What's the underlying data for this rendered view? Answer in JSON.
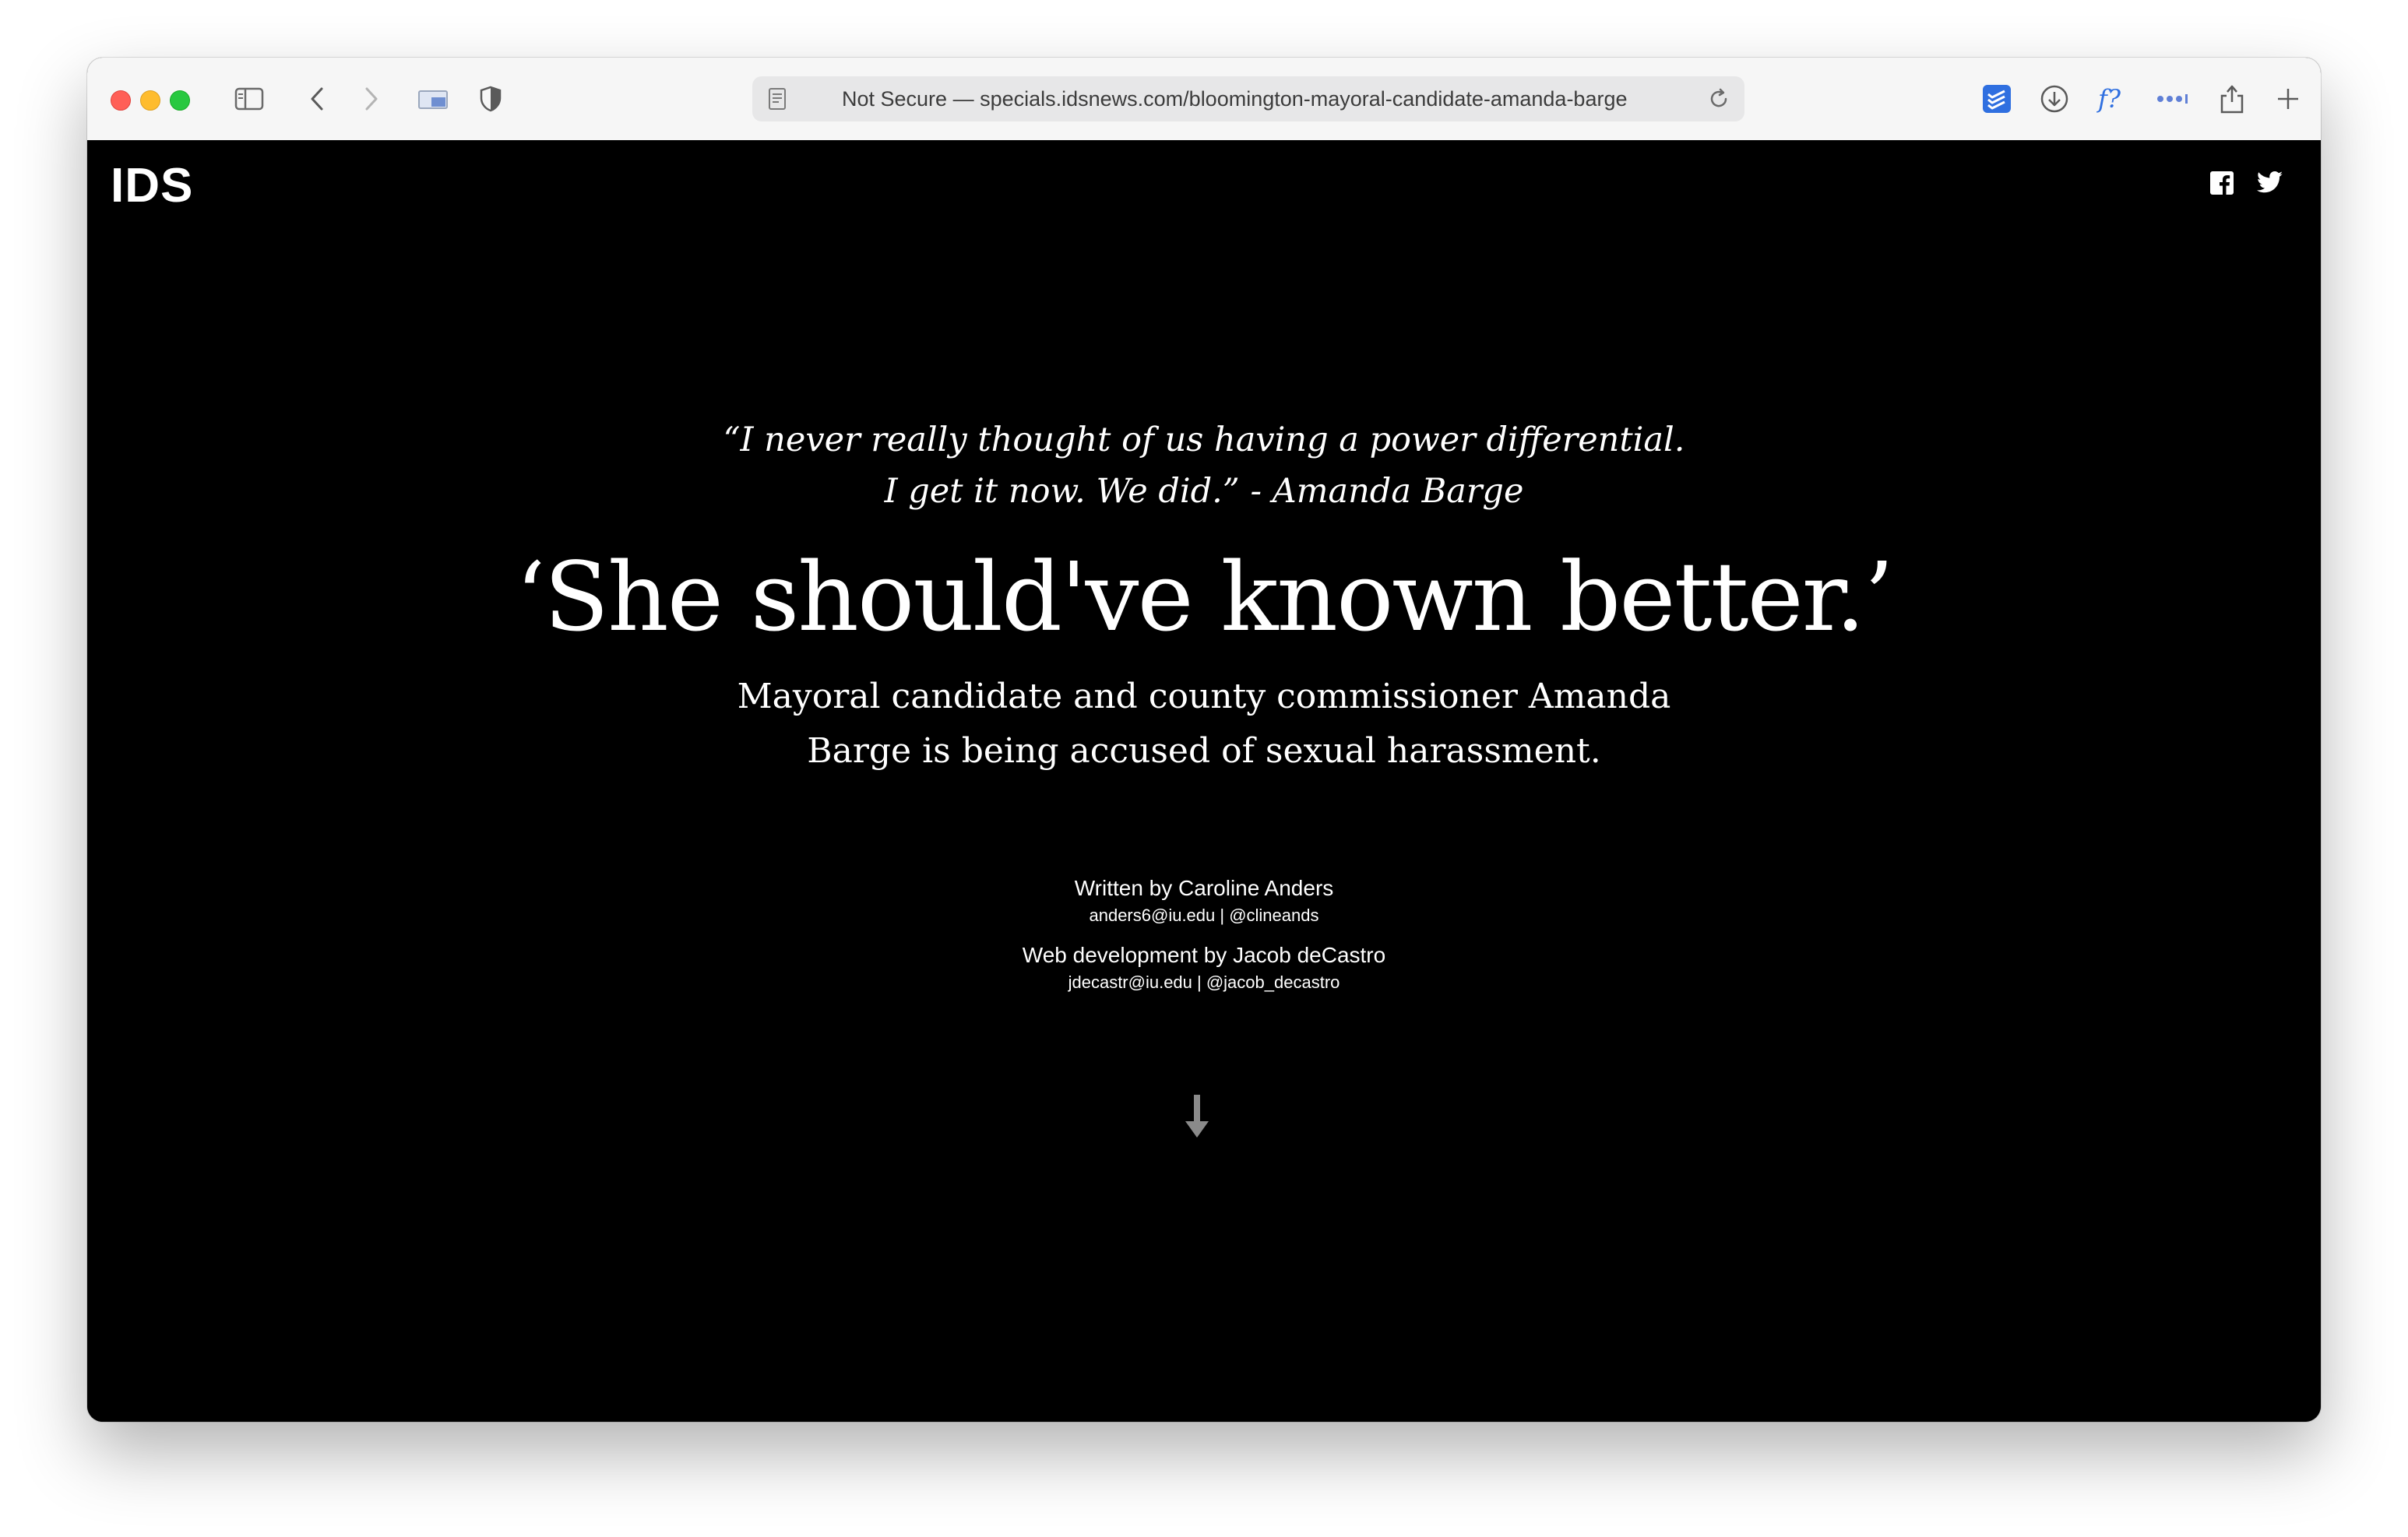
{
  "browser": {
    "address_bar_text": "Not Secure — specials.idsnews.com/bloomington-mayoral-candidate-amanda-barge",
    "icons": [
      "sidebar-icon",
      "back-icon",
      "forward-icon",
      "tab-overview-icon",
      "privacy-shield-icon",
      "reader-icon",
      "reload-icon",
      "todoist-extension-icon",
      "download-icon",
      "font-finder-icon",
      "more-extensions-icon",
      "share-icon",
      "new-tab-icon"
    ]
  },
  "site": {
    "logo": "IDS",
    "social": [
      "facebook-icon",
      "twitter-icon"
    ]
  },
  "article": {
    "quote_line1": "“I never really thought of us having a power differential.",
    "quote_line2": "I get it now. We did.” - Amanda Barge",
    "headline": "‘She should've known better.’",
    "dek_line1": "Mayoral candidate and county commissioner Amanda",
    "dek_line2": "Barge is being accused of sexual harassment.",
    "credits": [
      {
        "role": "Written by Caroline Anders",
        "contact": "anders6@iu.edu | @clineands"
      },
      {
        "role": "Web development by Jacob deCastro",
        "contact": "jdecastr@iu.edu | @jacob_decastro"
      }
    ]
  },
  "colors": {
    "page_background": "#000000",
    "text": "#ffffff",
    "arrow": "#8a8a8a",
    "extension_accent": "#2f6fe0"
  }
}
